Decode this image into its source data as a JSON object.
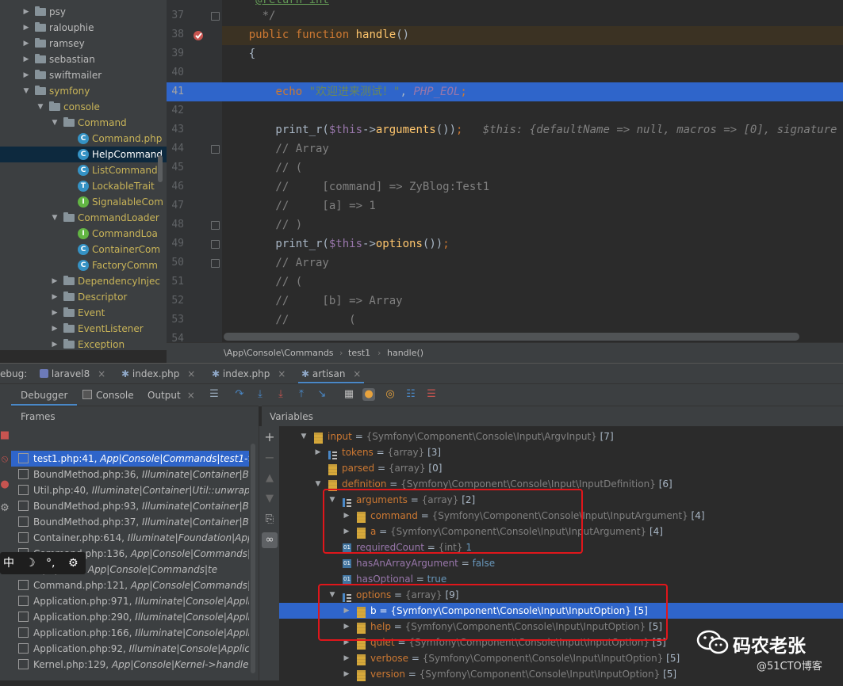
{
  "project_tree": {
    "items": [
      {
        "label": "psy",
        "type": "folder",
        "expanded": false
      },
      {
        "label": "ralouphie",
        "type": "folder",
        "expanded": false
      },
      {
        "label": "ramsey",
        "type": "folder",
        "expanded": false
      },
      {
        "label": "sebastian",
        "type": "folder",
        "expanded": false
      },
      {
        "label": "swiftmailer",
        "type": "folder",
        "expanded": false
      },
      {
        "label": "symfony",
        "type": "folder",
        "expanded": true
      },
      {
        "label": "console",
        "type": "folder",
        "expanded": true
      },
      {
        "label": "Command",
        "type": "folder",
        "expanded": true
      },
      {
        "label": "Command.php",
        "type": "class"
      },
      {
        "label": "HelpCommand",
        "type": "class",
        "selected": true
      },
      {
        "label": "ListCommand",
        "type": "class"
      },
      {
        "label": "LockableTrait",
        "type": "trait"
      },
      {
        "label": "SignalableCom",
        "type": "interface"
      },
      {
        "label": "CommandLoader",
        "type": "folder",
        "expanded": true
      },
      {
        "label": "CommandLoa",
        "type": "interface"
      },
      {
        "label": "ContainerCom",
        "type": "class"
      },
      {
        "label": "FactoryComm",
        "type": "class"
      },
      {
        "label": "DependencyInjec",
        "type": "folder",
        "expanded": false
      },
      {
        "label": "Descriptor",
        "type": "folder",
        "expanded": false
      },
      {
        "label": "Event",
        "type": "folder",
        "expanded": false
      },
      {
        "label": "EventListener",
        "type": "folder",
        "expanded": false
      },
      {
        "label": "Exception",
        "type": "folder",
        "expanded": false
      }
    ]
  },
  "editor": {
    "lines": [
      {
        "n": "37",
        "code": "      */"
      },
      {
        "n": "38",
        "code": "    public function handle()"
      },
      {
        "n": "39",
        "code": "    {"
      },
      {
        "n": "40",
        "code": ""
      },
      {
        "n": "41",
        "code": "        echo \"欢迎进来测试！\", PHP_EOL;"
      },
      {
        "n": "42",
        "code": ""
      },
      {
        "n": "43",
        "code": "        print_r($this->arguments());"
      },
      {
        "n": "44",
        "code": "        // Array"
      },
      {
        "n": "45",
        "code": "        // ("
      },
      {
        "n": "46",
        "code": "        //     [command] => ZyBlog:Test1"
      },
      {
        "n": "47",
        "code": "        //     [a] => 1"
      },
      {
        "n": "48",
        "code": "        // )"
      },
      {
        "n": "49",
        "code": "        print_r($this->options());"
      },
      {
        "n": "50",
        "code": "        // Array"
      },
      {
        "n": "51",
        "code": "        // ("
      },
      {
        "n": "52",
        "code": "        //     [b] => Array"
      },
      {
        "n": "53",
        "code": "        //         ("
      },
      {
        "n": "54",
        "code": ""
      }
    ],
    "inline_hint": "$this: {defaultName => null, macros => [0], signature => \"Zy",
    "return_partial": "@return int",
    "breadcrumb": [
      "\\App\\Console\\Commands",
      "test1",
      "handle()"
    ]
  },
  "debug_bar": {
    "label": "ebug:",
    "tabs": [
      "laravel8",
      "index.php",
      "index.php",
      "artisan"
    ],
    "active_tab": "artisan"
  },
  "debugger_tabs": [
    "Debugger",
    "Console",
    "Output"
  ],
  "frames": {
    "header": "Frames",
    "rows": [
      {
        "file": "test1.php:41,",
        "detail": "App|Console|Commands|test1->ha",
        "selected": true
      },
      {
        "file": "BoundMethod.php:36,",
        "detail": "Illuminate|Container|Bou"
      },
      {
        "file": "Util.php:40,",
        "detail": "Illuminate|Container|Util::unwrapIfC"
      },
      {
        "file": "BoundMethod.php:93,",
        "detail": "Illuminate|Container|Bou"
      },
      {
        "file": "BoundMethod.php:37,",
        "detail": "Illuminate|Container|Bou"
      },
      {
        "file": "Container.php:614,",
        "detail": "Illuminate|Foundation|Applic"
      },
      {
        "file": "Command.php:136,",
        "detail": "App|Console|Commands|te"
      },
      {
        "file": "...php:256,",
        "detail": "App|Console|Commands|te"
      },
      {
        "file": "Command.php:121,",
        "detail": "App|Console|Commands|tes"
      },
      {
        "file": "Application.php:971,",
        "detail": "Illuminate|Console|Applica"
      },
      {
        "file": "Application.php:290,",
        "detail": "Illuminate|Console|Applica"
      },
      {
        "file": "Application.php:166,",
        "detail": "Illuminate|Console|Applica"
      },
      {
        "file": "Application.php:92,",
        "detail": "Illuminate|Console|Applicat"
      },
      {
        "file": "Kernel.php:129,",
        "detail": "App|Console|Kernel->handle()"
      }
    ]
  },
  "variables": {
    "header": "Variables",
    "rows": [
      {
        "indent": 0,
        "arrow": "down",
        "icon": "obj",
        "name": "input",
        "type": "{Symfony\\Component\\Console\\Input\\ArgvInput}",
        "extra": "[7]"
      },
      {
        "indent": 1,
        "arrow": "right",
        "icon": "arr",
        "name": "tokens",
        "type": "{array}",
        "extra": "[3]"
      },
      {
        "indent": 1,
        "arrow": "",
        "icon": "obj",
        "name": "parsed",
        "type": "{array}",
        "extra": "[0]"
      },
      {
        "indent": 1,
        "arrow": "down",
        "icon": "obj",
        "name": "definition",
        "type": "{Symfony\\Component\\Console\\Input\\InputDefinition}",
        "extra": "[6]"
      },
      {
        "indent": 2,
        "arrow": "down",
        "icon": "arr",
        "name": "arguments",
        "type": "{array}",
        "extra": "[2]"
      },
      {
        "indent": 3,
        "arrow": "right",
        "icon": "obj",
        "name": "command",
        "type": "{Symfony\\Component\\Console\\Input\\InputArgument}",
        "extra": "[4]"
      },
      {
        "indent": 3,
        "arrow": "right",
        "icon": "obj",
        "name": "a",
        "type": "{Symfony\\Component\\Console\\Input\\InputArgument}",
        "extra": "[4]"
      },
      {
        "indent": 2,
        "arrow": "",
        "icon": "field",
        "name": "requiredCount",
        "type": "{int}",
        "extra": "1"
      },
      {
        "indent": 2,
        "arrow": "",
        "icon": "field",
        "name": "hasAnArrayArgument",
        "type": "",
        "extra": "false"
      },
      {
        "indent": 2,
        "arrow": "",
        "icon": "field",
        "name": "hasOptional",
        "type": "",
        "extra": "true"
      },
      {
        "indent": 2,
        "arrow": "down",
        "icon": "arr",
        "name": "options",
        "type": "{array}",
        "extra": "[9]"
      },
      {
        "indent": 3,
        "arrow": "right",
        "icon": "obj",
        "name": "b",
        "type": "{Symfony\\Component\\Console\\Input\\InputOption}",
        "extra": "[5]",
        "selected": true
      },
      {
        "indent": 3,
        "arrow": "right",
        "icon": "obj",
        "name": "help",
        "type": "{Symfony\\Component\\Console\\Input\\InputOption}",
        "extra": "[5]"
      },
      {
        "indent": 3,
        "arrow": "right",
        "icon": "obj",
        "name": "quiet",
        "type": "{Symfony\\Component\\Console\\Input\\InputOption}",
        "extra": "[5]"
      },
      {
        "indent": 3,
        "arrow": "right",
        "icon": "obj",
        "name": "verbose",
        "type": "{Symfony\\Component\\Console\\Input\\InputOption}",
        "extra": "[5]"
      },
      {
        "indent": 3,
        "arrow": "right",
        "icon": "obj",
        "name": "version",
        "type": "{Symfony\\Component\\Console\\Input\\InputOption}",
        "extra": "[5]"
      }
    ]
  },
  "ime_bar": {
    "label": "中",
    "icons": [
      "moon-icon",
      "punct-icon",
      "gear-icon"
    ]
  },
  "watermark": {
    "brand": "码农老张",
    "site": "@51CTO博客"
  },
  "colors": {
    "selection": "#2f65ca",
    "annotation_box": "#e0161b",
    "folder_label": "#c9b458"
  }
}
